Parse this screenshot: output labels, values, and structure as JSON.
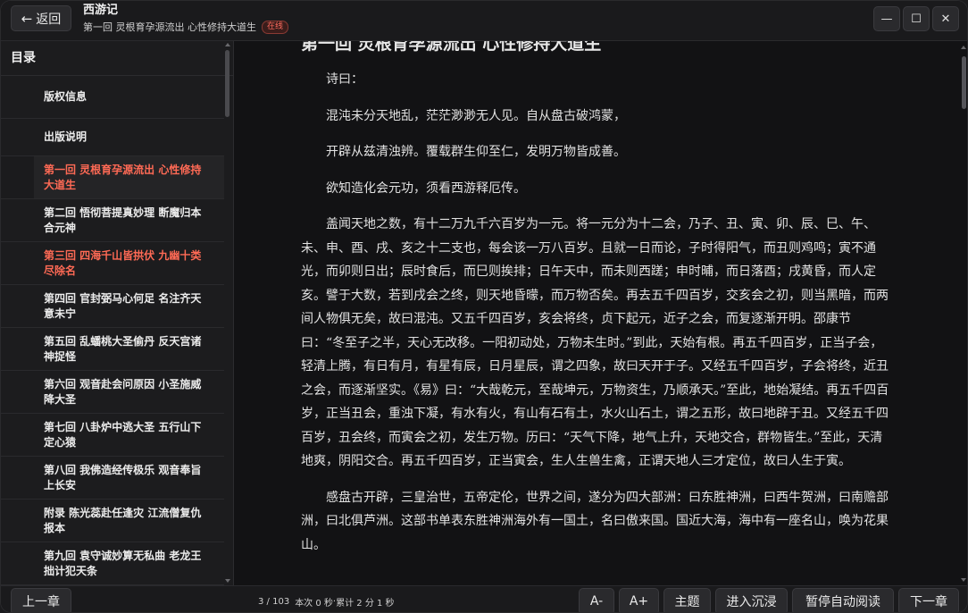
{
  "header": {
    "back_label": "返回",
    "book_title": "西游记",
    "chapter_subtitle": "第一回 灵根育孕源流出 心性修持大道生",
    "status_badge": "在线",
    "window_controls": {
      "minimize": "—",
      "maximize": "☐",
      "close": "✕"
    }
  },
  "sidebar": {
    "title": "目录",
    "items": [
      {
        "label": "版权信息",
        "state": "normal"
      },
      {
        "label": "出版说明",
        "state": "normal"
      },
      {
        "label": "第一回 灵根育孕源流出 心性修持大道生",
        "state": "active"
      },
      {
        "label": "第二回 悟彻菩提真妙理 断魔归本合元神",
        "state": "normal"
      },
      {
        "label": "第三回 四海千山皆拱伏 九幽十类尽除名",
        "state": "highlight"
      },
      {
        "label": "第四回 官封弼马心何足 名注齐天意未宁",
        "state": "normal"
      },
      {
        "label": "第五回 乱蟠桃大圣偷丹 反天宫诸神捉怪",
        "state": "normal"
      },
      {
        "label": "第六回 观音赴会问原因 小圣施威降大圣",
        "state": "normal"
      },
      {
        "label": "第七回 八卦炉中逃大圣 五行山下定心猿",
        "state": "normal"
      },
      {
        "label": "第八回 我佛造经传极乐 观音奉旨上长安",
        "state": "normal"
      },
      {
        "label": "附录 陈光蕊赴任逢灾 江流僧复仇报本",
        "state": "normal"
      },
      {
        "label": "第九回 袁守诚妙算无私曲 老龙王拙计犯天条",
        "state": "normal"
      }
    ]
  },
  "content": {
    "chapter_heading": "第一回 灵根育孕源流出 心性修持大道生",
    "paragraphs": [
      "诗曰：",
      "混沌未分天地乱，茫茫渺渺无人见。自从盘古破鸿蒙，",
      "开辟从兹清浊辨。覆载群生仰至仁，发明万物皆成善。",
      "欲知造化会元功，须看西游释厄传。",
      "盖闻天地之数，有十二万九千六百岁为一元。将一元分为十二会，乃子、丑、寅、卯、辰、巳、午、未、申、酉、戌、亥之十二支也，每会该一万八百岁。且就一日而论，子时得阳气，而丑则鸡鸣；寅不通光，而卯则日出；辰时食后，而巳则挨排；日午天中，而未则西蹉；申时晡，而日落酉；戌黄昏，而人定亥。譬于大数，若到戌会之终，则天地昏曚，而万物否矣。再去五千四百岁，交亥会之初，则当黑暗，而两间人物俱无矣，故曰混沌。又五千四百岁，亥会将终，贞下起元，近子之会，而复逐渐开明。邵康节曰：“冬至子之半，天心无改移。一阳初动处，万物未生时。”到此，天始有根。再五千四百岁，正当子会，轻清上腾，有日有月，有星有辰，日月星辰，谓之四象，故曰天开于子。又经五千四百岁，子会将终，近丑之会，而逐渐坚实。《易》曰：“大哉乾元，至哉坤元，万物资生，乃顺承天。”至此，地始凝结。再五千四百岁，正当丑会，重浊下凝，有水有火，有山有石有土，水火山石土，谓之五形，故曰地辟于丑。又经五千四百岁，丑会终，而寅会之初，发生万物。历曰：“天气下降，地气上升，天地交合，群物皆生。”至此，天清地爽，阴阳交合。再五千四百岁，正当寅会，生人生兽生禽，正谓天地人三才定位，故曰人生于寅。",
      "感盘古开辟，三皇治世，五帝定伦，世界之间，遂分为四大部洲：曰东胜神洲，曰西牛贺洲，曰南赡部洲，曰北俱芦洲。这部书单表东胜神洲海外有一国土，名曰傲来国。国近大海，海中有一座名山，唤为花果山。"
    ]
  },
  "footer": {
    "prev_label": "上一章",
    "page_indicator": "3 / 103",
    "session_time": "本次 0 秒",
    "total_time": "累计 2 分 1 秒",
    "font_smaller": "A-",
    "font_larger": "A+",
    "theme_label": "主题",
    "immersive_label": "进入沉浸",
    "autoread_label": "暂停自动阅读",
    "next_label": "下一章"
  },
  "colors": {
    "accent": "#ff6a55",
    "background": "#121214",
    "sidebar": "#1c1c1e"
  }
}
